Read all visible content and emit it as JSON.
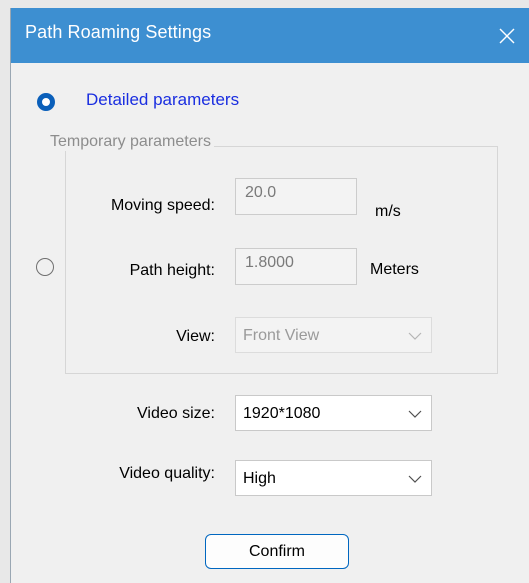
{
  "window": {
    "title": "Path Roaming Settings",
    "close_icon": "close-icon"
  },
  "mode": {
    "detailed_label": "Detailed parameters",
    "detailed_selected": true,
    "temporary_selected": false
  },
  "temporary_group": {
    "title": "Temporary parameters",
    "moving_speed": {
      "label": "Moving speed:",
      "value": "20.0",
      "unit": "m/s"
    },
    "path_height": {
      "label": "Path height:",
      "value": "1.8000",
      "unit": "Meters"
    },
    "view": {
      "label": "View:",
      "value": "Front View"
    }
  },
  "video": {
    "size": {
      "label": "Video size:",
      "value": "1920*1080"
    },
    "quality": {
      "label": "Video quality:",
      "value": "High"
    }
  },
  "buttons": {
    "confirm_label": "Confirm"
  },
  "colors": {
    "titlebar": "#3d8fd1",
    "accent": "#0a5fba",
    "link_text": "#1a2ee0"
  }
}
